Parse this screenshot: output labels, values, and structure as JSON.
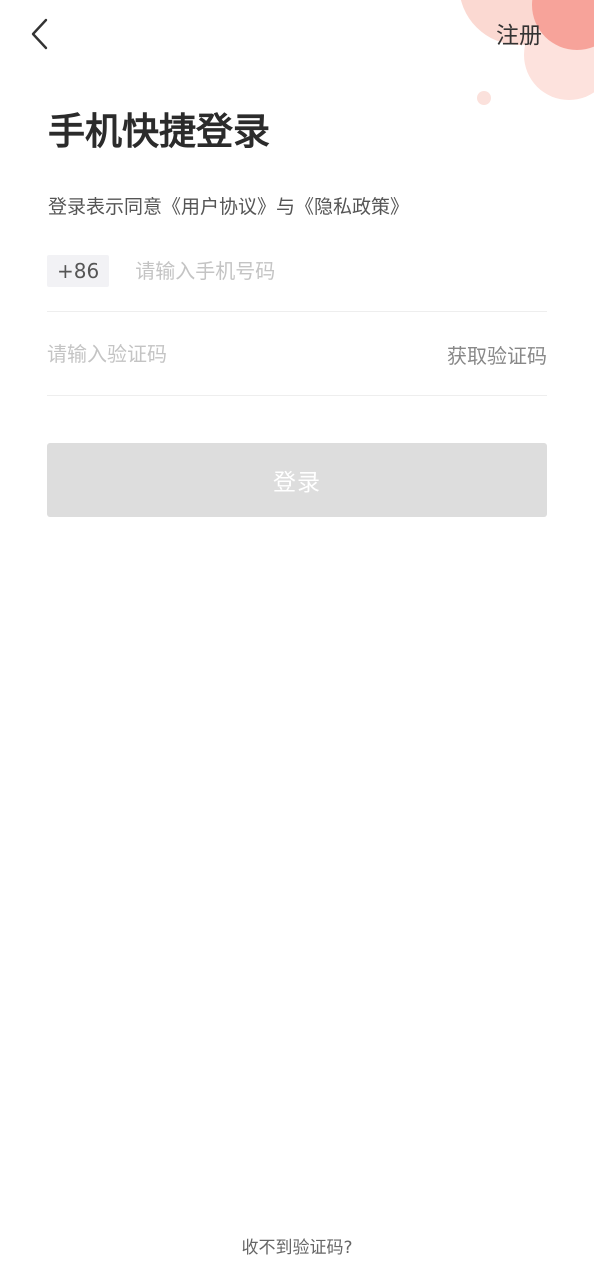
{
  "header": {
    "back_icon": "chevron-left-icon",
    "register_label": "注册"
  },
  "title": "手机快捷登录",
  "agreement": {
    "prefix": "登录表示同意",
    "user_agreement": "《用户协议》",
    "connector": "与",
    "privacy_policy": "《隐私政策》"
  },
  "phone": {
    "country_code": "+86",
    "value": "",
    "placeholder": "请输入手机号码"
  },
  "verification": {
    "value": "",
    "placeholder": "请输入验证码",
    "get_code_label": "获取验证码"
  },
  "login_button_label": "登录",
  "footer": {
    "no_code_label": "收不到验证码?"
  },
  "colors": {
    "accent": "#f7a39a",
    "button_disabled": "#dddddd"
  }
}
